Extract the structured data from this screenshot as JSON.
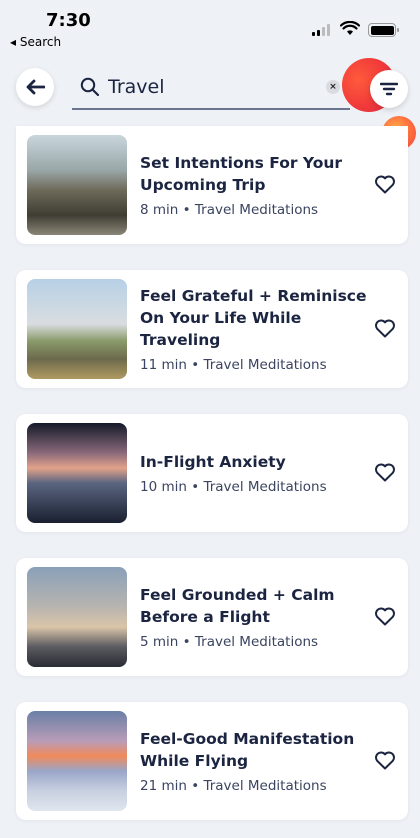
{
  "status_bar": {
    "time": "7:30",
    "back_app_label": "◂ Search"
  },
  "search": {
    "value": "Travel",
    "clear_symbol": "×"
  },
  "icons": {
    "back": "arrow-left-icon",
    "search": "magnifier-icon",
    "filter": "filter-lines-icon",
    "favorite": "heart-outline-icon"
  },
  "colors": {
    "accent_orb": "#f03a3a",
    "accent_orb_small": "#ff8a3d",
    "text_primary": "#1b2440",
    "background": "#eef1f6"
  },
  "results": [
    {
      "title": "Set Intentions For Your Upcoming Trip",
      "meta": "8 min • Travel Meditations"
    },
    {
      "title": "Feel Grateful + Reminisce On Your Life While Traveling",
      "meta": "11 min • Travel Meditations"
    },
    {
      "title": "In-Flight Anxiety",
      "meta": "10 min • Travel Meditations"
    },
    {
      "title": "Feel Grounded + Calm Before a Flight",
      "meta": "5 min • Travel Meditations"
    },
    {
      "title": "Feel-Good Manifestation While Flying",
      "meta": "21 min • Travel Meditations"
    }
  ]
}
